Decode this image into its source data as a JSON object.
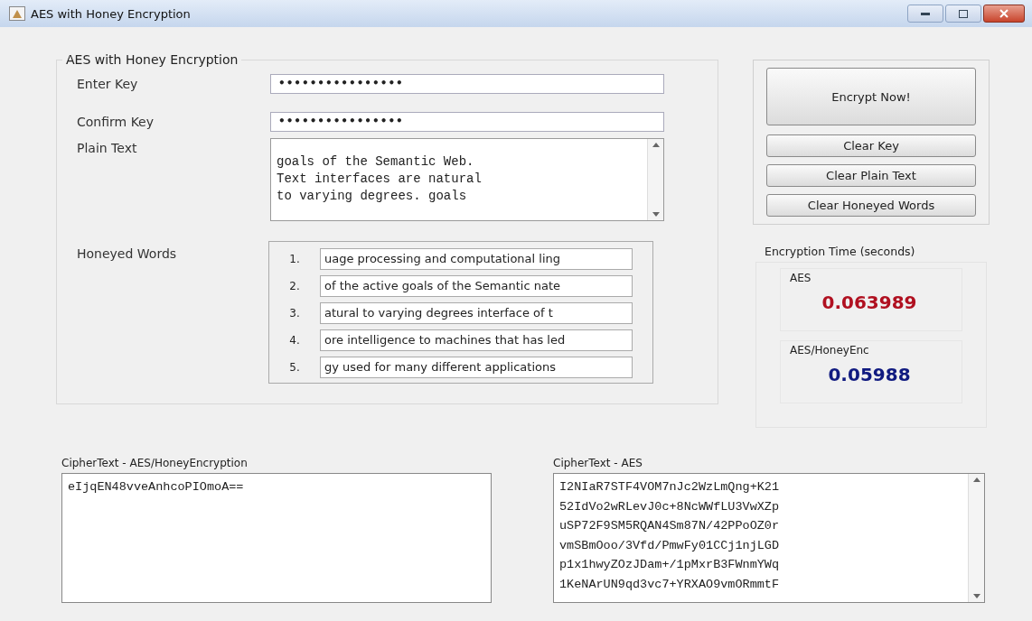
{
  "window": {
    "title": "AES with Honey Encryption"
  },
  "main_group": {
    "title": "AES with Honey Encryption",
    "enter_key": {
      "label": "Enter Key",
      "value": "••••••••••••••••"
    },
    "confirm_key": {
      "label": "Confirm Key",
      "value": "••••••••••••••••"
    },
    "plain_text": {
      "label": "Plain Text",
      "lines": [
        "goals of the Semantic Web.",
        "Text interfaces are natural",
        "to varying degrees. goals"
      ]
    },
    "honeyed_words": {
      "label": "Honeyed Words",
      "items": [
        {
          "number": "1.",
          "text": "uage processing and computational ling"
        },
        {
          "number": "2.",
          "text": "of the active goals of the Semantic nate"
        },
        {
          "number": "3.",
          "text": "atural to varying degrees interface of t"
        },
        {
          "number": "4.",
          "text": "ore intelligence to machines that has led"
        },
        {
          "number": "5.",
          "text": "gy used for many different applications"
        }
      ]
    }
  },
  "buttons": [
    {
      "label": "Encrypt Now!",
      "kind": "primary"
    },
    {
      "label": "Clear Key",
      "kind": "small"
    },
    {
      "label": "Clear Plain Text",
      "kind": "small"
    },
    {
      "label": "Clear Honeyed Words",
      "kind": "small"
    }
  ],
  "encryption_time": {
    "title": "Encryption Time (seconds)",
    "results": [
      {
        "label": "AES",
        "value": "0.063989",
        "color": "#b01020"
      },
      {
        "label": "AES/HoneyEnc",
        "value": "0.05988",
        "color": "#101a80"
      }
    ]
  },
  "ciphertexts": [
    {
      "label": "CipherText - AES/HoneyEncryption",
      "lines": [
        "eIjqEN48vveAnhcoPIOmoA=="
      ],
      "scrollbar": false
    },
    {
      "label": "CipherText - AES",
      "lines": [
        "I2NIaR7STF4VOM7nJc2WzLmQng+K21",
        "52IdVo2wRLevJ0c+8NcWWfLU3VwXZp",
        "uSP72F9SM5RQAN4Sm87N/42PPoOZ0r",
        "vmSBmOoo/3Vfd/PmwFy01CCj1njLGD",
        "p1x1hwyZOzJDam+/1pMxrB3FWnmYWq",
        "1KeNArUN9qd3vc7+YRXAO9vmORmmtF"
      ],
      "scrollbar": true
    }
  ]
}
